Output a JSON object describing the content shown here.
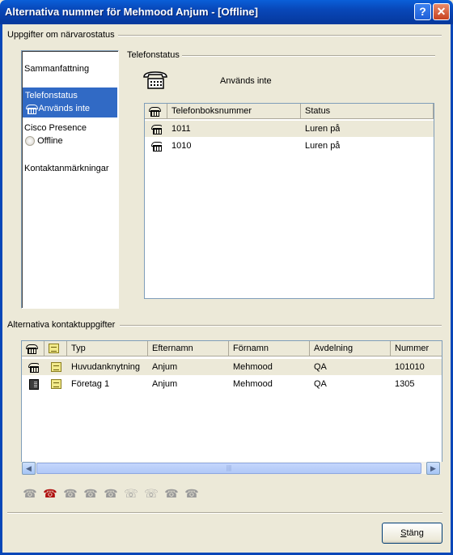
{
  "window": {
    "title": "Alternativa nummer för Mehmood Anjum - [Offline]",
    "help_glyph": "?",
    "close_glyph": "✕"
  },
  "presence_group": {
    "label": "Uppgifter om närvarostatus"
  },
  "nav": {
    "items": [
      {
        "label": "Sammanfattning"
      },
      {
        "label": "Telefonstatus",
        "sub": "Används inte"
      },
      {
        "label": "Cisco Presence",
        "sub": "Offline"
      },
      {
        "label": "Kontaktanmärkningar"
      }
    ]
  },
  "phone_status": {
    "group_label": "Telefonstatus",
    "status_text": "Används inte",
    "table": {
      "headers": [
        "Telefonboksnummer",
        "Status"
      ],
      "rows": [
        {
          "number": "1011",
          "status": "Luren på"
        },
        {
          "number": "1010",
          "status": "Luren på"
        }
      ]
    }
  },
  "alt_contact": {
    "group_label": "Alternativa kontaktuppgifter",
    "headers": [
      "Typ",
      "Efternamn",
      "Förnamn",
      "Avdelning",
      "Nummer"
    ],
    "rows": [
      {
        "type": "Huvudanknytning",
        "last": "Anjum",
        "first": "Mehmood",
        "dept": "QA",
        "number": "101010",
        "icon": "phone-icon"
      },
      {
        "type": "Företag 1",
        "last": "Anjum",
        "first": "Mehmood",
        "dept": "QA",
        "number": "1305",
        "icon": "desk-phone-icon"
      }
    ]
  },
  "scrollbar": {
    "left_arrow": "◀",
    "right_arrow": "▶",
    "grip": "|||"
  },
  "toolbar": {
    "icons": [
      "call-icon",
      "dial-icon",
      "transfer-icon",
      "conference-icon",
      "voicemail-icon",
      "hold-icon",
      "forward-icon",
      "hangup-icon",
      "edit-icon"
    ],
    "glyphs": [
      "☎",
      "☎",
      "☎",
      "☎",
      "☎",
      "☏",
      "☏",
      "☎",
      "☎"
    ]
  },
  "footer": {
    "close_label_mnemonic": "S",
    "close_label_rest": "täng"
  },
  "colors": {
    "titlebar": "#0847b8",
    "selection": "#316ac5",
    "face": "#ece9d8"
  }
}
